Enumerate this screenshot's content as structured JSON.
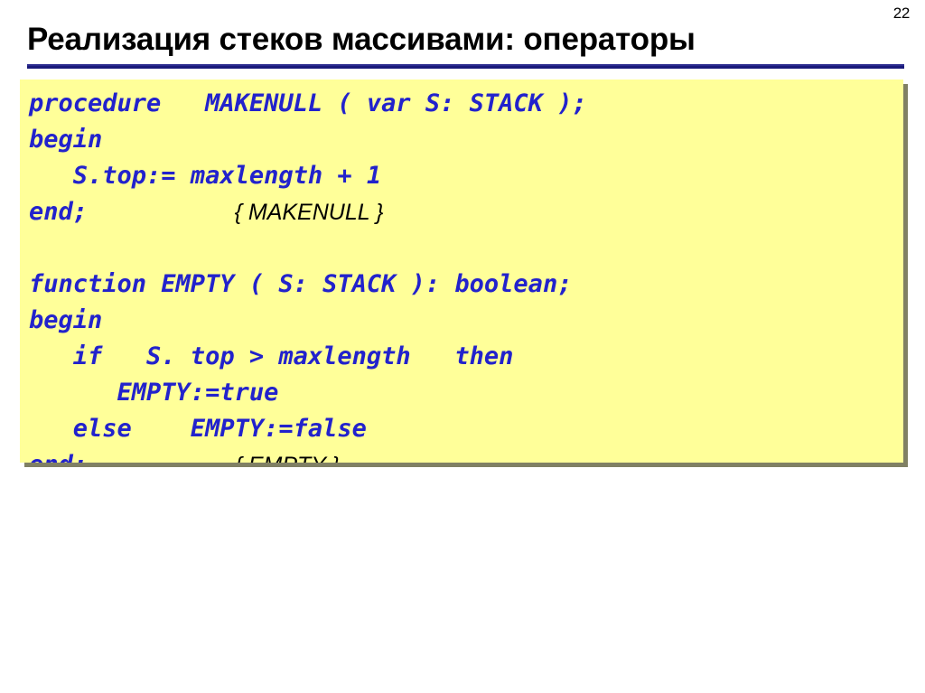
{
  "slide": {
    "number": "22",
    "title": "Реализация стеков массивами: операторы",
    "colors": {
      "title_text": "#000000",
      "underline": "#1a1a7a",
      "panel_background": "#ffff99",
      "panel_shadow": "#808064",
      "code_text": "#2222cc",
      "comment_text": "#000000",
      "page_background": "#ffffff"
    }
  },
  "code_panel": {
    "lines": [
      {
        "code": "procedure   MAKENULL ( var S: STACK );",
        "comment": ""
      },
      {
        "code": "begin",
        "comment": ""
      },
      {
        "code": "   S.top:= maxlength + 1",
        "comment": ""
      },
      {
        "code": "end;          ",
        "comment": "{ MAKENULL }"
      },
      {
        "code": "",
        "comment": ""
      },
      {
        "code": "function EMPTY ( S: STACK ): boolean;",
        "comment": ""
      },
      {
        "code": "begin",
        "comment": ""
      },
      {
        "code": "   if   S. top > maxlength   then",
        "comment": ""
      },
      {
        "code": "      EMPTY:=true",
        "comment": ""
      },
      {
        "code": "   else    EMPTY:=false",
        "comment": ""
      },
      {
        "code": "end;          ",
        "comment": "{ EMPTY }"
      }
    ]
  }
}
